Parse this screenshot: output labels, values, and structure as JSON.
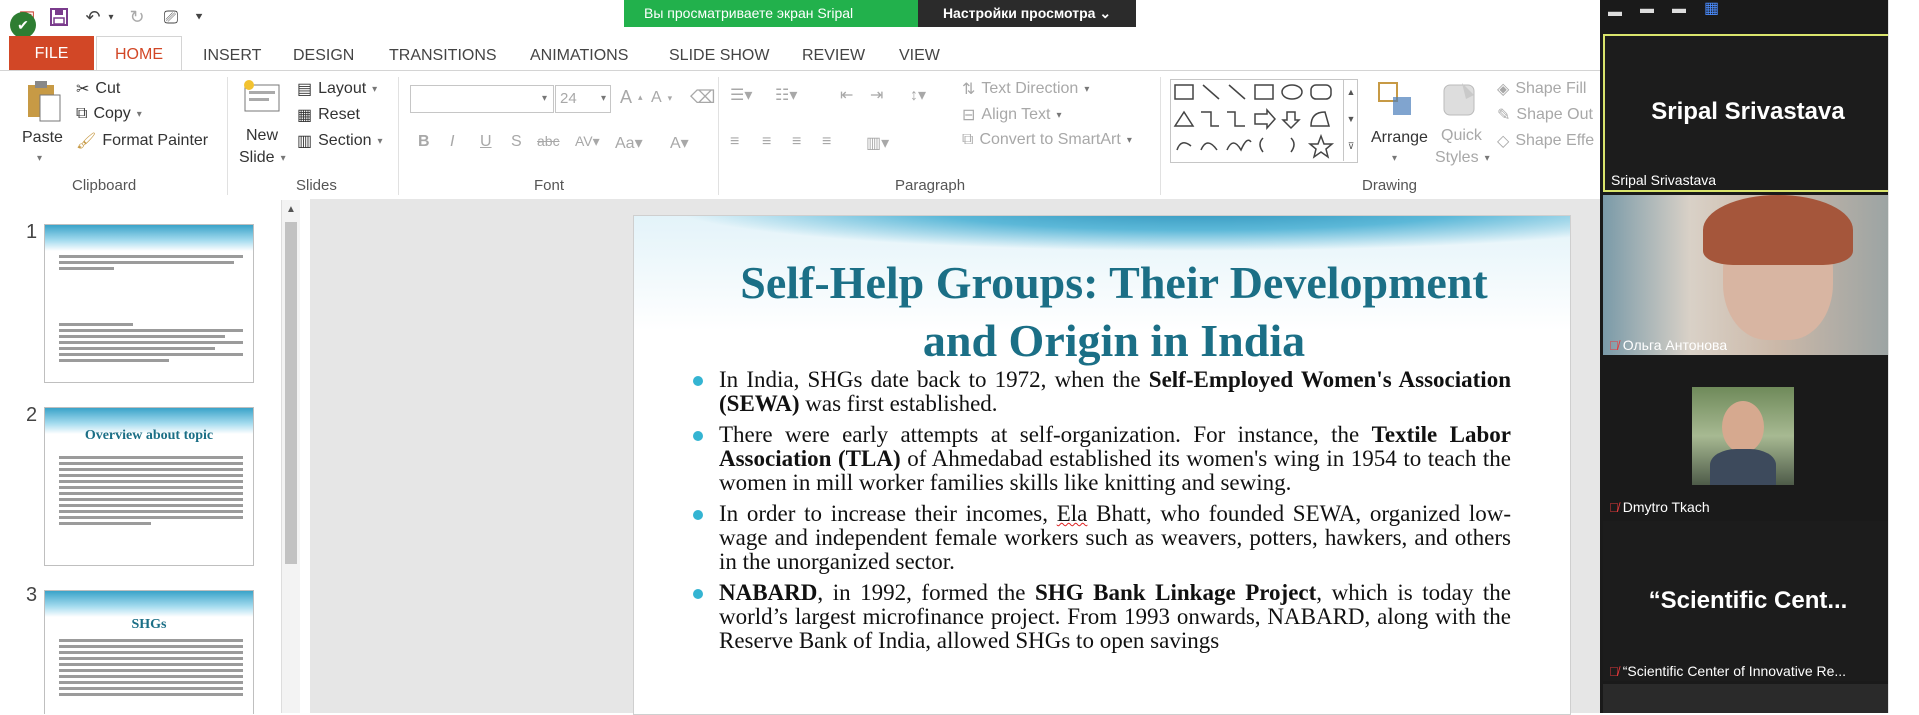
{
  "app": {
    "tabs": {
      "file": "FILE",
      "home": "HOME",
      "insert": "INSERT",
      "design": "DESIGN",
      "transitions": "TRANSITIONS",
      "animations": "ANIMATIONS",
      "slide_show": "SLIDE SHOW",
      "review": "REVIEW",
      "view": "VIEW"
    },
    "accent": "#d24726"
  },
  "share_banner": {
    "viewing": "Вы просматриваете экран Sripal Srivastava",
    "view_settings": "Настройки просмотра"
  },
  "ribbon": {
    "clipboard": {
      "paste": "Paste",
      "cut": "Cut",
      "copy": "Copy",
      "format_painter": "Format Painter",
      "label": "Clipboard"
    },
    "slides": {
      "new_slide_1": "New",
      "new_slide_2": "Slide",
      "layout": "Layout",
      "reset": "Reset",
      "section": "Section",
      "label": "Slides"
    },
    "font": {
      "size": "24",
      "label": "Font"
    },
    "paragraph": {
      "text_direction": "Text Direction",
      "align_text": "Align Text",
      "convert_smartart": "Convert to SmartArt",
      "label": "Paragraph"
    },
    "drawing": {
      "arrange": "Arrange",
      "quick_1": "Quick",
      "quick_2": "Styles",
      "shape_fill": "Shape Fill",
      "shape_outline": "Shape Out",
      "shape_effects": "Shape Effe",
      "label": "Drawing"
    }
  },
  "thumbnails": [
    {
      "num": "1",
      "title": ""
    },
    {
      "num": "2",
      "title": "Overview about topic"
    },
    {
      "num": "3",
      "title": "SHGs"
    }
  ],
  "slide": {
    "title_line1": "Self-Help Groups: Their Development",
    "title_line2": "and Origin in India",
    "bullets": {
      "b1_pre": "In India, SHGs date back to 1972, when the ",
      "b1_bold": "Self-Employed Women's Association (SEWA)",
      "b1_post": " was first established.",
      "b2_pre": "There were early attempts at self-organization. For instance, the ",
      "b2_bold": "Textile Labor Association (TLA)",
      "b2_post": " of Ahmedabad established its women's wing in 1954 to teach the women in mill worker families skills like knitting and sewing.",
      "b3_pre": "In order to increase their incomes, ",
      "b3_squig": "Ela",
      "b3_post": " Bhatt, who founded SEWA, organized low-wage and independent female workers such as weavers, potters, hawkers, and others in the unorganized sector.",
      "b4_bold1": "NABARD",
      "b4_mid": ", in 1992, formed the ",
      "b4_bold2": "SHG Bank Linkage Project",
      "b4_post": ", which is today the world’s largest microfinance project. From 1993 onwards, NABARD, along with the Reserve Bank of India, allowed SHGs to open savings"
    }
  },
  "gallery": {
    "p1_big": "Sripal Srivastava",
    "p1_name": "Sripal Srivastava",
    "p2_name": "Ольга Антонова",
    "p3_name": "Dmytro Tkach",
    "p4_big": "“Scientific  Cent...",
    "p4_name": "“Scientific Center of Innovative Re..."
  }
}
